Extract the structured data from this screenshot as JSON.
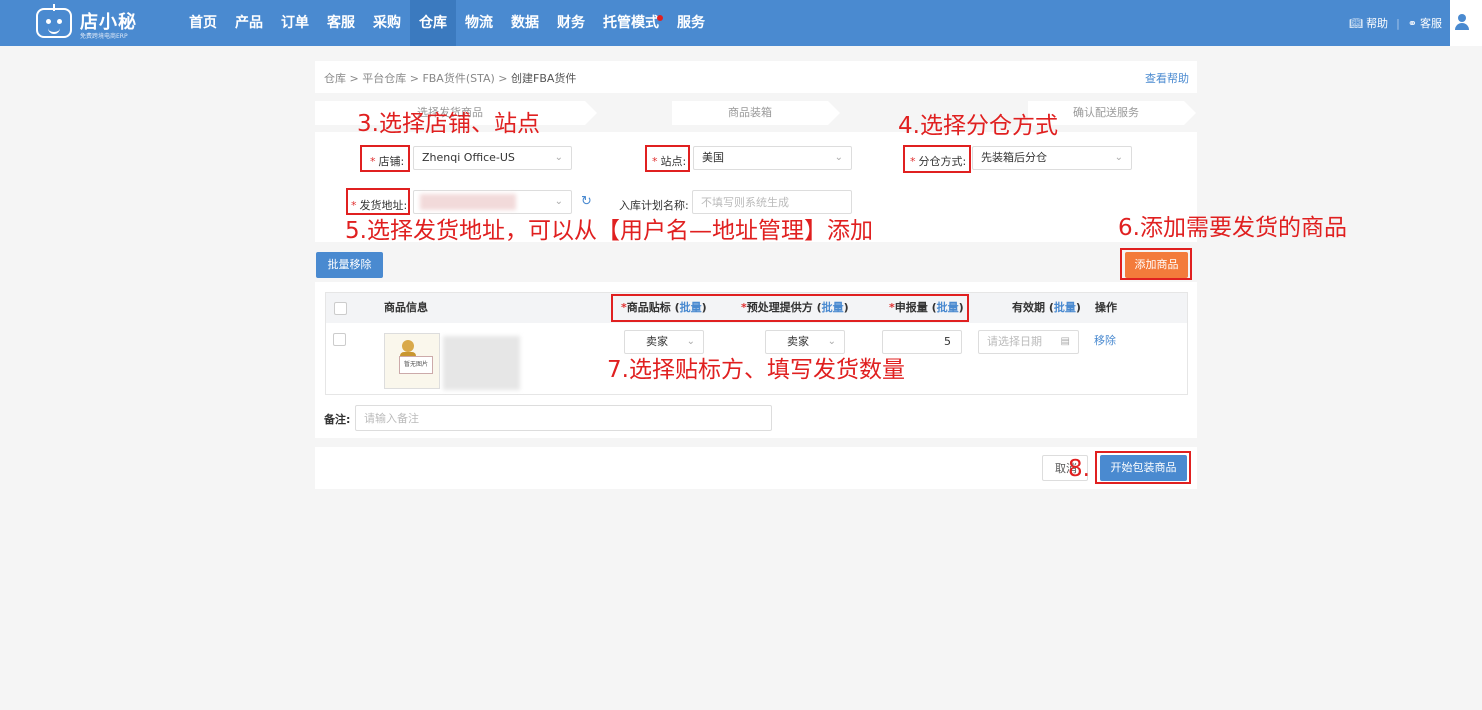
{
  "app": {
    "logo_text": "店小秘",
    "logo_subtitle": "免费跨境电商ERP"
  },
  "nav": {
    "items": [
      {
        "label": "首页"
      },
      {
        "label": "产品"
      },
      {
        "label": "订单"
      },
      {
        "label": "客服"
      },
      {
        "label": "采购"
      },
      {
        "label": "仓库",
        "active": true
      },
      {
        "label": "物流"
      },
      {
        "label": "数据"
      },
      {
        "label": "财务"
      },
      {
        "label": "托管模式",
        "badge_dot": true
      },
      {
        "label": "服务"
      }
    ],
    "help_label": "帮助",
    "service_label": "客服"
  },
  "breadcrumb": {
    "items": [
      "仓库",
      "平台仓库",
      "FBA货件(STA)"
    ],
    "separator": ">",
    "current": "创建FBA货件"
  },
  "help_link": "查看帮助",
  "steps": [
    "选择发货商品",
    "商品装箱",
    "确认配送服务"
  ],
  "form": {
    "store_label": "店铺:",
    "store_value": "Zhenqi Office-US",
    "site_label": "站点:",
    "site_value": "美国",
    "split_label": "分仓方式:",
    "split_value": "先装箱后分仓",
    "address_label": "发货地址:",
    "plan_name_label": "入库计划名称:",
    "plan_name_placeholder": "不填写则系统生成"
  },
  "actions": {
    "batch_remove": "批量移除",
    "add_product": "添加商品",
    "cancel": "取消",
    "start_pack": "开始包装商品"
  },
  "table": {
    "headers": {
      "product_info": "商品信息",
      "label_owner": "商品贴标",
      "prep_owner": "预处理提供方",
      "declared_qty": "申报量",
      "expiry": "有效期",
      "batch": "批量",
      "operation": "操作"
    },
    "rows": [
      {
        "image_text": "暂无图片",
        "label_owner": "卖家",
        "prep_owner": "卖家",
        "declared_qty": "5",
        "expiry_placeholder": "请选择日期",
        "remove": "移除"
      }
    ]
  },
  "remark": {
    "label": "备注:",
    "placeholder": "请输入备注"
  },
  "annotations": {
    "a3": "3.选择店铺、站点",
    "a4": "4.选择分仓方式",
    "a5": "5.选择发货地址，可以从【用户名—地址管理】添加",
    "a6": "6.添加需要发货的商品",
    "a7": "7.选择贴标方、填写发货数量",
    "a8": "8."
  },
  "colors": {
    "nav_bg": "#4a8ad0",
    "primary": "#4a8ad0",
    "orange": "#f37b3b",
    "annotation_red": "#e02020"
  }
}
